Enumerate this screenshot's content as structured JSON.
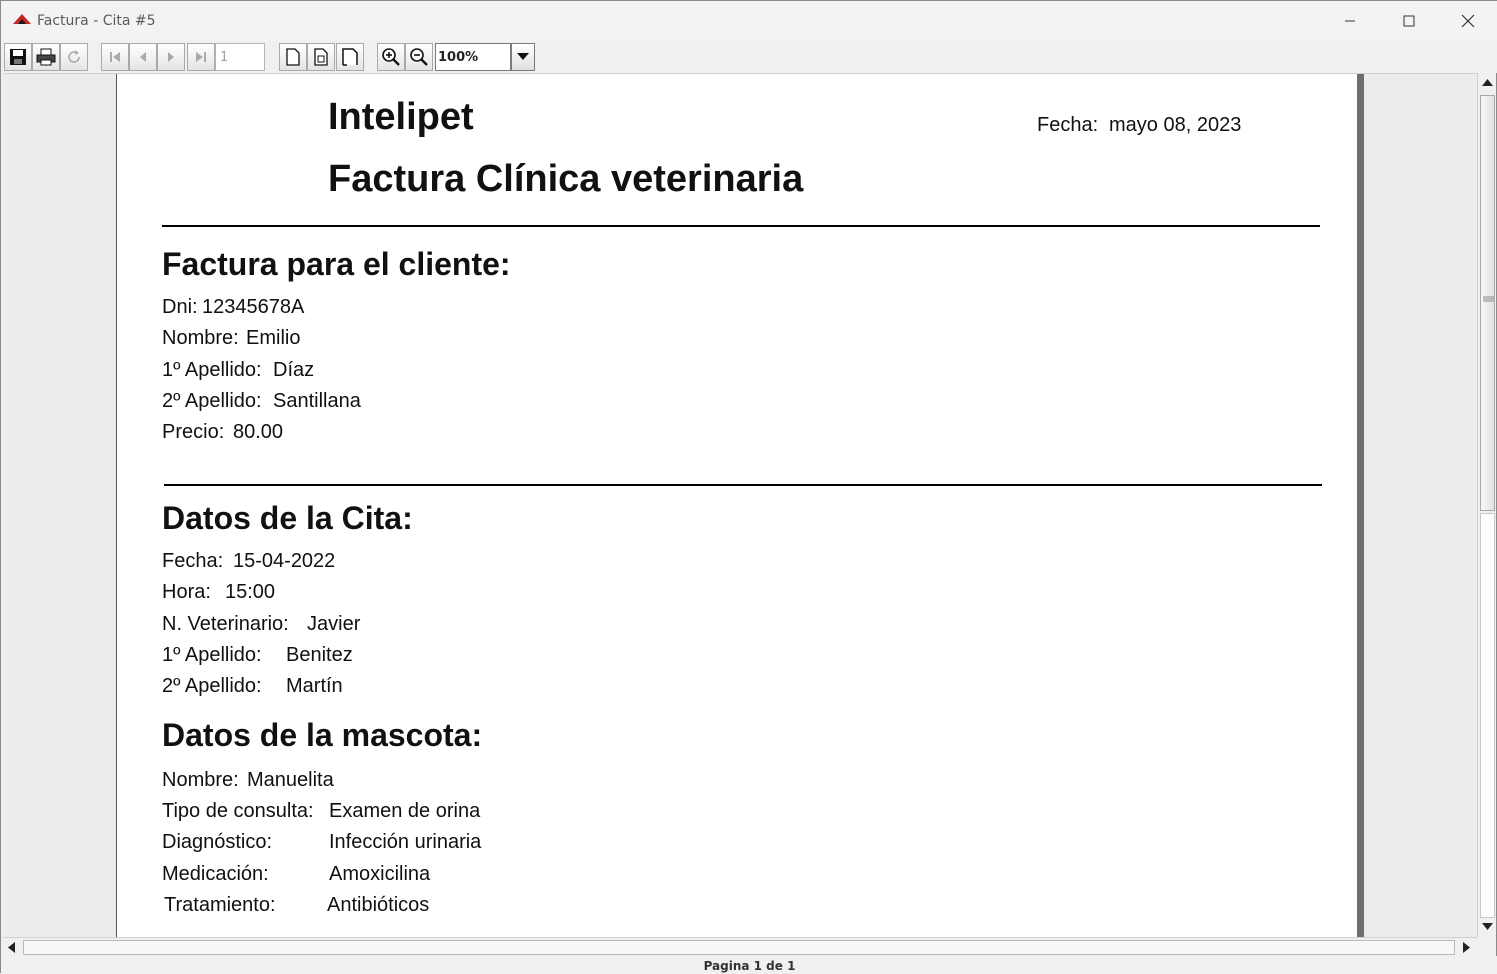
{
  "window": {
    "title": "Factura - Cita #5",
    "minimize_glyph": "—",
    "maximize_glyph": "☐",
    "close_glyph": "✕"
  },
  "toolbar": {
    "buttons": [
      "save-icon",
      "print-icon",
      "reload-icon",
      "first-page-icon",
      "previous-page-icon",
      "next-page-icon",
      "last-page-icon",
      "actual-size-icon",
      "fit-page-icon",
      "fit-width-icon",
      "zoom-in-icon",
      "zoom-out-icon"
    ],
    "page_number": "1",
    "zoom_value": "100%"
  },
  "report": {
    "brand": "Intelipet",
    "title": "Factura Clínica veterinaria",
    "date_label": "Fecha:",
    "date_value": "mayo 08, 2023",
    "client": {
      "heading": "Factura para el cliente:",
      "dni_label": "Dni:",
      "dni": "12345678A",
      "nombre_label": "Nombre:",
      "nombre": "Emilio",
      "apellido1_label": "1º Apellido:",
      "apellido1": "Díaz",
      "apellido2_label": "2º Apellido:",
      "apellido2": "Santillana",
      "precio_label": "Precio:",
      "precio": "80.00"
    },
    "appointment": {
      "heading": "Datos de la Cita:",
      "fecha_label": "Fecha:",
      "fecha": "15-04-2022",
      "hora_label": "Hora:",
      "hora": "15:00",
      "vet_label": "N. Veterinario:",
      "vet": "Javier",
      "apellido1_label": "1º Apellido:",
      "apellido1": "Benitez",
      "apellido2_label": "2º Apellido:",
      "apellido2": "Martín"
    },
    "pet": {
      "heading": "Datos de la mascota:",
      "nombre_label": "Nombre:",
      "nombre": "Manuelita",
      "consulta_label": "Tipo de consulta:",
      "consulta": "Examen de orina",
      "diagnostico_label": "Diagnóstico:",
      "diagnostico": "Infección urinaria",
      "medicacion_label": "Medicación:",
      "medicacion": "Amoxicilina",
      "tratamiento_label": "Tratamiento:",
      "tratamiento": "Antibióticos"
    }
  },
  "status": {
    "page_info": "Pagina 1 de 1"
  }
}
